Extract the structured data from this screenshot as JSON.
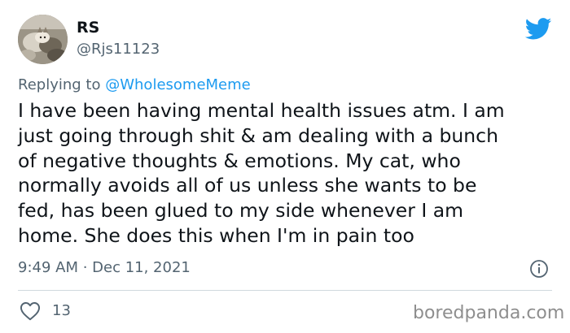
{
  "tweet": {
    "author_name": "RS",
    "author_handle": "@Rjs11123",
    "replying_prefix": "Replying to",
    "replying_to": "@WholesomeMeme",
    "text": "I have been having mental health issues atm. I am\njust going through shit & am dealing with a bunch\nof negative thoughts & emotions. My cat, who\nnormally avoids all of us unless she wants to be\nfed, has been glued to my side whenever I am\nhome. She does this when I'm in pain too",
    "timestamp": "9:49 AM · Dec 11, 2021",
    "like_count": "13"
  },
  "icons": {
    "brand": "twitter-bird-icon",
    "info": "info-icon",
    "like": "heart-icon"
  },
  "colors": {
    "text_primary": "#0f1419",
    "text_secondary": "#536471",
    "accent": "#1d9bf0",
    "divider": "#cfd9de",
    "watermark": "#8e8e8e"
  },
  "watermark": "boredpanda.com"
}
